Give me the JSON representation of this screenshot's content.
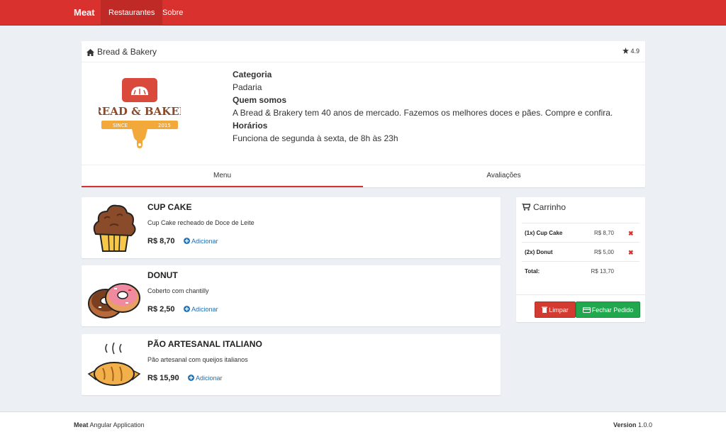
{
  "nav": {
    "brand": "Meat",
    "items": [
      "Restaurantes",
      "Sobre"
    ]
  },
  "restaurant": {
    "name": "Bread & Bakery",
    "rating": "4.9",
    "logo": {
      "title": "BREAD & BAKERY",
      "since": "SINCE",
      "year": "2015"
    },
    "category_label": "Categoria",
    "category": "Padaria",
    "about_label": "Quem somos",
    "about": "A Bread & Brakery tem 40 anos de mercado. Fazemos os melhores doces e pães. Compre e confira.",
    "hours_label": "Horários",
    "hours": "Funciona de segunda à sexta, de 8h às 23h"
  },
  "tabs": [
    "Menu",
    "Avaliações"
  ],
  "menu": [
    {
      "name": "CUP CAKE",
      "description": "Cup Cake recheado de Doce de Leite",
      "price": "R$ 8,70",
      "add": "Adicionar",
      "icon": "cupcake-image"
    },
    {
      "name": "DONUT",
      "description": "Coberto com chantilly",
      "price": "R$ 2,50",
      "add": "Adicionar",
      "icon": "donut-image"
    },
    {
      "name": "PÃO ARTESANAL ITALIANO",
      "description": "Pão artesanal com queijos italianos",
      "price": "R$ 15,90",
      "add": "Adicionar",
      "icon": "bread-image"
    }
  ],
  "cart": {
    "title": "Carrinho",
    "items": [
      {
        "name": "(1x) Cup Cake",
        "value": "R$ 8,70"
      },
      {
        "name": "(2x) Donut",
        "value": "R$ 5,00"
      }
    ],
    "total_label": "Total:",
    "total": "R$ 13,70",
    "clear_label": "Limpar",
    "order_label": "Fechar Pedido"
  },
  "footer": {
    "brand": "Meat",
    "text": "Angular Application",
    "version_label": "Version",
    "version": "1.0.0"
  },
  "colors": {
    "primary": "#d9312e",
    "success": "#21a84e",
    "link": "#1f6fb2",
    "background": "#ecf0f5"
  }
}
